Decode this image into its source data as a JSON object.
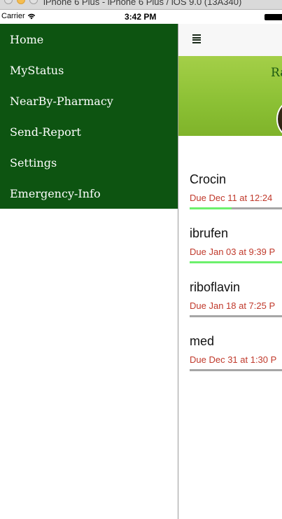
{
  "window": {
    "title": "iPhone 6 Plus - iPhone 6 Plus / iOS 9.0 (13A340)"
  },
  "statusbar": {
    "carrier": "Carrier",
    "time": "3:42 PM"
  },
  "menu": {
    "items": [
      {
        "label": "Home"
      },
      {
        "label": "MyStatus"
      },
      {
        "label": "NearBy-Pharmacy"
      },
      {
        "label": "Send-Report"
      },
      {
        "label": "Settings"
      },
      {
        "label": "Emergency-Info"
      }
    ]
  },
  "banner": {
    "text": "Ra"
  },
  "medicines": [
    {
      "name": "Crocin",
      "due": "Due Dec 11 at 12:24",
      "progress": 0.45
    },
    {
      "name": "ibrufen",
      "due": "Due Jan 03 at 9:39 P",
      "progress": 1.0
    },
    {
      "name": "riboflavin",
      "due": "Due Jan 18 at 7:25 P",
      "progress": 0.0
    },
    {
      "name": "med",
      "due": "Due Dec 31 at 1:30 P",
      "progress": 0.0
    }
  ],
  "colors": {
    "menu_bg": "#0d5411",
    "banner_bg": "#8bc034",
    "due_text": "#c0392b",
    "progress_fill": "#6cf06c",
    "progress_track": "#a6a6a6"
  }
}
